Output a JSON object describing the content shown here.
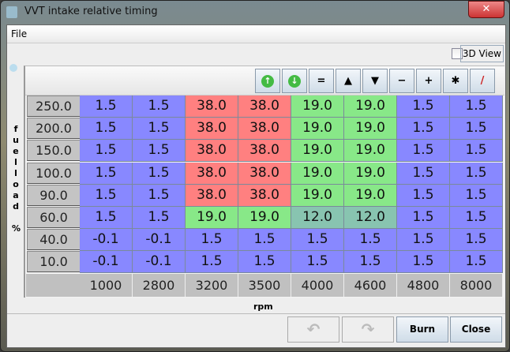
{
  "window": {
    "title": "VVT intake relative timing",
    "close": "✕"
  },
  "menu": {
    "file": "File"
  },
  "view3d": {
    "label": "3D View",
    "checked": false
  },
  "toolbar": [
    {
      "name": "increment-green-button",
      "glyph": "↑"
    },
    {
      "name": "decrement-green-button",
      "glyph": "↓"
    },
    {
      "name": "equals-button",
      "glyph": "="
    },
    {
      "name": "up-button",
      "glyph": "▲"
    },
    {
      "name": "down-button",
      "glyph": "▼"
    },
    {
      "name": "minus-button",
      "glyph": "−"
    },
    {
      "name": "plus-button",
      "glyph": "+"
    },
    {
      "name": "multiply-button",
      "glyph": "✱"
    },
    {
      "name": "interpolate-button",
      "glyph": "/"
    }
  ],
  "y_axis": {
    "label": [
      "f",
      "u",
      "e",
      "l",
      "l",
      "o",
      "a",
      "d",
      "",
      "%"
    ],
    "values": [
      "250.0",
      "200.0",
      "150.0",
      "100.0",
      "90.0",
      "60.0",
      "40.0",
      "10.0"
    ]
  },
  "x_axis": {
    "label": "rpm",
    "values": [
      "1000",
      "2800",
      "3200",
      "3500",
      "4000",
      "4600",
      "4800",
      "8000"
    ]
  },
  "table": [
    [
      "1.5",
      "1.5",
      "38.0",
      "38.0",
      "19.0",
      "19.0",
      "1.5",
      "1.5"
    ],
    [
      "1.5",
      "1.5",
      "38.0",
      "38.0",
      "19.0",
      "19.0",
      "1.5",
      "1.5"
    ],
    [
      "1.5",
      "1.5",
      "38.0",
      "38.0",
      "19.0",
      "19.0",
      "1.5",
      "1.5"
    ],
    [
      "1.5",
      "1.5",
      "38.0",
      "38.0",
      "19.0",
      "19.0",
      "1.5",
      "1.5"
    ],
    [
      "1.5",
      "1.5",
      "38.0",
      "38.0",
      "19.0",
      "19.0",
      "1.5",
      "1.5"
    ],
    [
      "1.5",
      "1.5",
      "19.0",
      "19.0",
      "12.0",
      "12.0",
      "1.5",
      "1.5"
    ],
    [
      "-0.1",
      "-0.1",
      "1.5",
      "1.5",
      "1.5",
      "1.5",
      "1.5",
      "1.5"
    ],
    [
      "-0.1",
      "-0.1",
      "1.5",
      "1.5",
      "1.5",
      "1.5",
      "1.5",
      "1.5"
    ]
  ],
  "colors": {
    "38.0": "#ff8080",
    "19.0": "#88e888",
    "12.0": "#88c4b0",
    "default": "#8888ff"
  },
  "buttons": {
    "undo": "↶",
    "redo": "↷",
    "burn": "Burn",
    "close": "Close"
  }
}
